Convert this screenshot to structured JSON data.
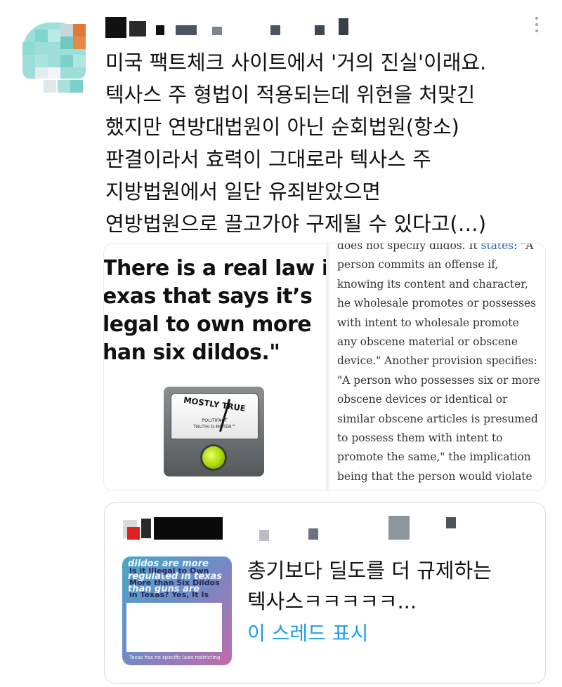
{
  "tweet": {
    "text_lines": [
      "미국 팩트체크 사이트에서 '거의 진실'이래요.",
      "텍사스 주 형법이 적용되는데 위헌을 처맞긴",
      "했지만 연방대법원이 아닌 순회법원(항소)",
      "판결이라서 효력이 그대로라 텍사스 주",
      "지방법원에서 일단 유죄받았으면",
      "연방법원으로 끌고가야 구제될 수 있다고(…)"
    ]
  },
  "media": {
    "headline_lines": [
      "There is a real law ir",
      "exas that says it’s",
      "legal to own more",
      "han six dildos.\""
    ],
    "meter": {
      "rating": "MOSTLY TRUE",
      "brand_line1": "POLITIFACT",
      "brand_line2": "TRUTH-O-METER™",
      "light_color": "#a6d800"
    },
    "article_lines": [
      "does not specify dildos. It ",
      "person commits an offense if,",
      "knowing its content and character,",
      "he wholesale promotes or possesses",
      "with intent to wholesale promote",
      "any obscene material or obscene",
      "device.\" Another provision specifies:",
      "\"A person who possesses six or more",
      "obscene devices or identical or",
      "similar obscene articles is presumed",
      "to possess them with intent to",
      "promote the same,\" the implication",
      "being that the person would violate"
    ],
    "article_link_text": "states",
    "article_after_link": ": \"A"
  },
  "quote": {
    "thumb_top_lines": [
      "dildos are more",
      "regulated in texas",
      "than guns are"
    ],
    "thumb_box_lines": [
      "Is it Illegal to Own",
      "More than Six Dildos",
      "in Texas? Yes, It Is"
    ],
    "thumb_caption": "Texas has no specific laws restricting",
    "text_lines": [
      "총기보다 딜도를 더 규제하는",
      "텍사스ㅋㅋㅋㅋㅋ..."
    ],
    "show_thread_label": "이 스레드 표시"
  },
  "colors": {
    "link": "#1d9bf0",
    "article_link": "#2b5fad"
  },
  "icons": {
    "more": "vertical-ellipsis"
  }
}
